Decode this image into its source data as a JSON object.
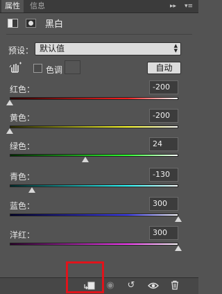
{
  "tabs": {
    "properties": "属性",
    "info": "信息"
  },
  "tab_controls": {
    "collapse": "▸▸",
    "menu": "▾≡"
  },
  "header": {
    "title": "黑白"
  },
  "preset": {
    "label": "预设：",
    "value": "默认值",
    "arrows": "▲▼"
  },
  "tint": {
    "label": "色调",
    "checked": false,
    "auto_button": "自动"
  },
  "sliders": [
    {
      "label": "红色：",
      "value": "-200",
      "level": 0.0,
      "gradient": [
        "#2a0000",
        "#ff2020"
      ]
    },
    {
      "label": "黄色：",
      "value": "-200",
      "level": 0.0,
      "gradient": [
        "#2a2a00",
        "#ffff30"
      ]
    },
    {
      "label": "绿色：",
      "value": "24",
      "level": 0.45,
      "gradient": [
        "#002a00",
        "#30ff30"
      ]
    },
    {
      "label": "青色：",
      "value": "-130",
      "level": 0.13,
      "gradient": [
        "#002a2a",
        "#30ffff"
      ]
    },
    {
      "label": "蓝色：",
      "value": "300",
      "level": 1.0,
      "gradient": [
        "#00002a",
        "#4040ff"
      ]
    },
    {
      "label": "洋红：",
      "value": "300",
      "level": 1.0,
      "gradient": [
        "#2a002a",
        "#ff40ff"
      ]
    }
  ],
  "bottom_icons": [
    "clip-to-layer-icon",
    "view-previous-icon",
    "reset-icon",
    "visibility-icon",
    "delete-icon"
  ],
  "colors": {
    "panel": "#535353",
    "highlight_box": "#e0131b"
  }
}
